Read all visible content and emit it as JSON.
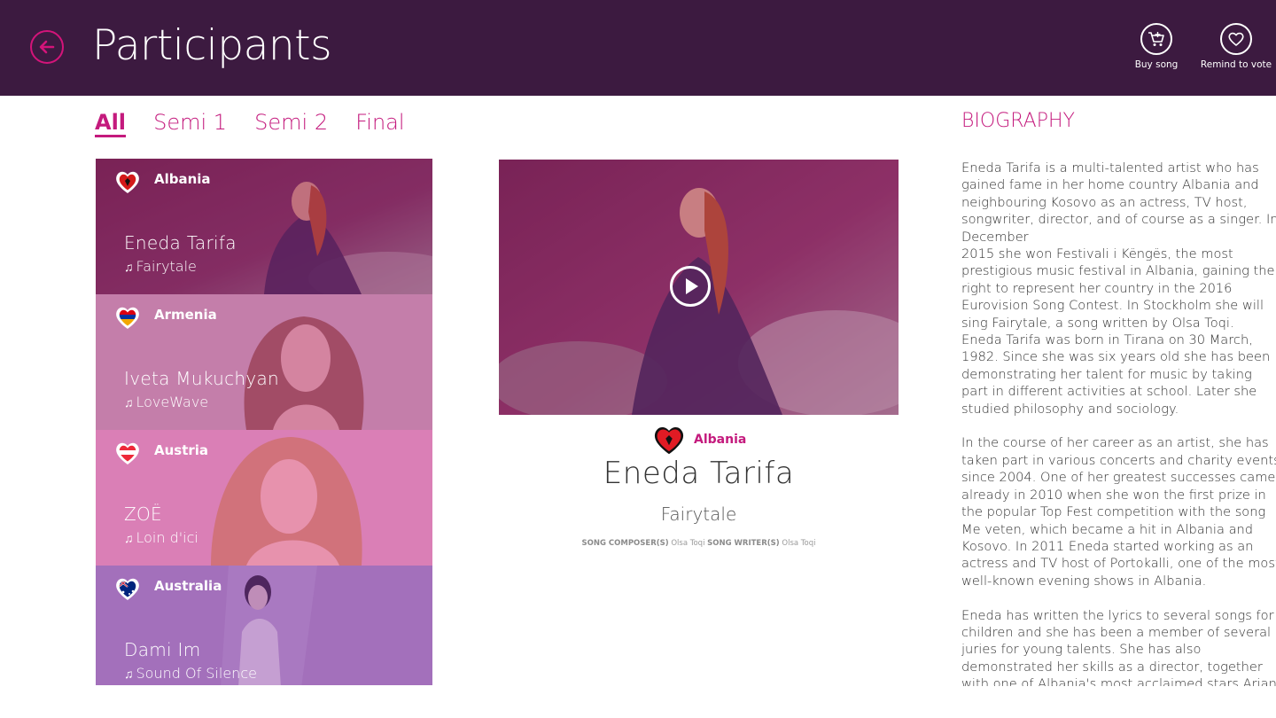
{
  "header": {
    "title": "Participants",
    "back_icon": "back-arrow-icon",
    "actions": [
      {
        "label": "Buy song",
        "icon": "cart-icon"
      },
      {
        "label": "Remind to vote",
        "icon": "heart-icon"
      }
    ]
  },
  "tabs": [
    {
      "label": "All",
      "active": true
    },
    {
      "label": "Semi 1",
      "active": false
    },
    {
      "label": "Semi 2",
      "active": false
    },
    {
      "label": "Final",
      "active": false
    }
  ],
  "participants": [
    {
      "country": "Albania",
      "artist": "Eneda Tarifa",
      "song": "Fairytale"
    },
    {
      "country": "Armenia",
      "artist": "Iveta Mukuchyan",
      "song": "LoveWave"
    },
    {
      "country": "Austria",
      "artist": "ZOË",
      "song": "Loin d'ici"
    },
    {
      "country": "Australia",
      "artist": "Dami Im",
      "song": "Sound Of Silence"
    }
  ],
  "detail": {
    "country": "Albania",
    "artist": "Eneda Tarifa",
    "song": "Fairytale",
    "composer_label": "SONG COMPOSER(S)",
    "composer": "Olsa Toqi",
    "writer_label": "SONG WRITER(S)",
    "writer": "Olsa Toqi"
  },
  "biography": {
    "title": "BIOGRAPHY",
    "paragraphs": [
      "Eneda Tarifa is a multi-talented artist who has gained fame in her home country Albania and neighbouring Kosovo as an actress, TV host, songwriter, director, and of course as a singer. In December\n2015 she won Festivali i Këngës, the most prestigious music festival in Albania, gaining the right to represent her country in the 2016 Eurovision Song Contest. In Stockholm she will sing Fairytale, a song written by Olsa Toqi.\nEneda Tarifa was born in Tirana on 30 March, 1982. Since she was six years old she has been demonstrating her talent for music by taking part in different activities at school. Later she studied philosophy and sociology.",
      "In the course of her career as an artist, she has taken part in various concerts and charity events since 2004. One of her greatest successes came already in 2010 when she won the first prize in the popular Top Fest competition with the song Me veten, which became a hit in Albania and Kosovo. In 2011 Eneda started working as an actress and TV host of Portokalli, one of the most well-known evening shows in Albania.",
      "Eneda has written the lyrics to several songs for children and she has been a member of several juries for young talents. She has also demonstrated her skills as a director, together with one of Albania's most acclaimed stars Arjan Culiqi. Together they created the comical soap opera Piruet which was a"
    ]
  },
  "colors": {
    "header_bg": "#3c1a40",
    "accent": "#c41a7d",
    "back_ring": "#d4147a"
  }
}
